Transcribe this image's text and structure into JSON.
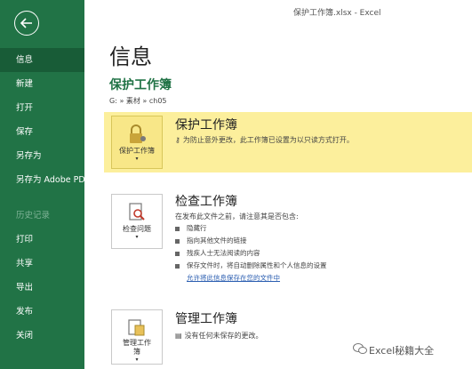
{
  "window": {
    "title": "保护工作簿.xlsx - Excel"
  },
  "sidebar": {
    "items": [
      {
        "label": "信息",
        "active": true
      },
      {
        "label": "新建"
      },
      {
        "label": "打开"
      },
      {
        "label": "保存"
      },
      {
        "label": "另存为"
      },
      {
        "label": "另存为 Adobe PDF"
      },
      {
        "label": "历史记录",
        "disabled": true
      },
      {
        "label": "打印"
      },
      {
        "label": "共享"
      },
      {
        "label": "导出"
      },
      {
        "label": "发布"
      },
      {
        "label": "关闭"
      }
    ]
  },
  "main": {
    "title": "信息",
    "section_title": "保护工作簿",
    "path": "G: » 素材 » ch05",
    "protect": {
      "tile_label": "保护工作簿",
      "heading": "保护工作簿",
      "text": "为防止意外更改，此工作簿已设置为以只读方式打开。"
    },
    "inspect": {
      "tile_label": "检查问题",
      "heading": "检查工作簿",
      "intro": "在发布此文件之前，请注意其是否包含:",
      "bullets": [
        "隐藏行",
        "指向其他文件的链接",
        "残疾人士无法阅读的内容",
        "保存文件时，将自动删除属性和个人信息的设置"
      ],
      "link": "允许将此信息保存在您的文件中"
    },
    "manage": {
      "tile_label": "管理工作簿",
      "heading": "管理工作簿",
      "text": "没有任何未保存的更改。"
    }
  },
  "watermark": "Excel秘籍大全",
  "colors": {
    "sidebar": "#217346",
    "active": "#185c37",
    "protect_bg": "#fcef9c",
    "link": "#2a5db0"
  }
}
